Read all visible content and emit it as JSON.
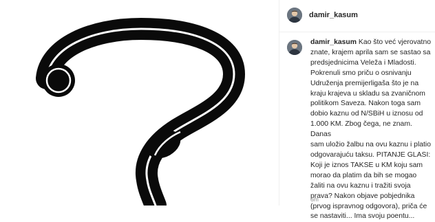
{
  "post": {
    "username": "damir_kasum",
    "caption_username": "damir_kasum",
    "caption_text": " Kao što već vjerovatno\nznate, krajem aprila sam se sastao sa\npredsjednicima Veleža i Mladosti.\nPokrenuli smo priču o osnivanju\nUdruženja premijerligaša što je na\nkraju krajeva u skladu sa zvaničnom\npolitikom Saveza. Nakon toga sam\ndobio kaznu od N/SBiH u iznosu od\n1.000 KM. Zbog čega, ne znam. Danas\nsam uložio žalbu na ovu kaznu i platio\nodgovarajuću taksu. PITANJE GLASI:\nKoji je iznos TAKSE u KM koju sam\nmorao da platim da bih se mogao\nžaliti na ovu kaznu i tražiti svoja\nprava? Nakon objave pobjednika\n(prvog ispravnog odgovora), priča će\nse nastaviti... Ima svoju poentu...",
    "timestamp": "6m"
  },
  "icons": {
    "image": "question-mark-image",
    "avatar": "user-avatar"
  },
  "colors": {
    "text": "#262626",
    "muted": "#8e8e8e",
    "border": "#efefef",
    "question_mark": "#0a0a0a"
  }
}
